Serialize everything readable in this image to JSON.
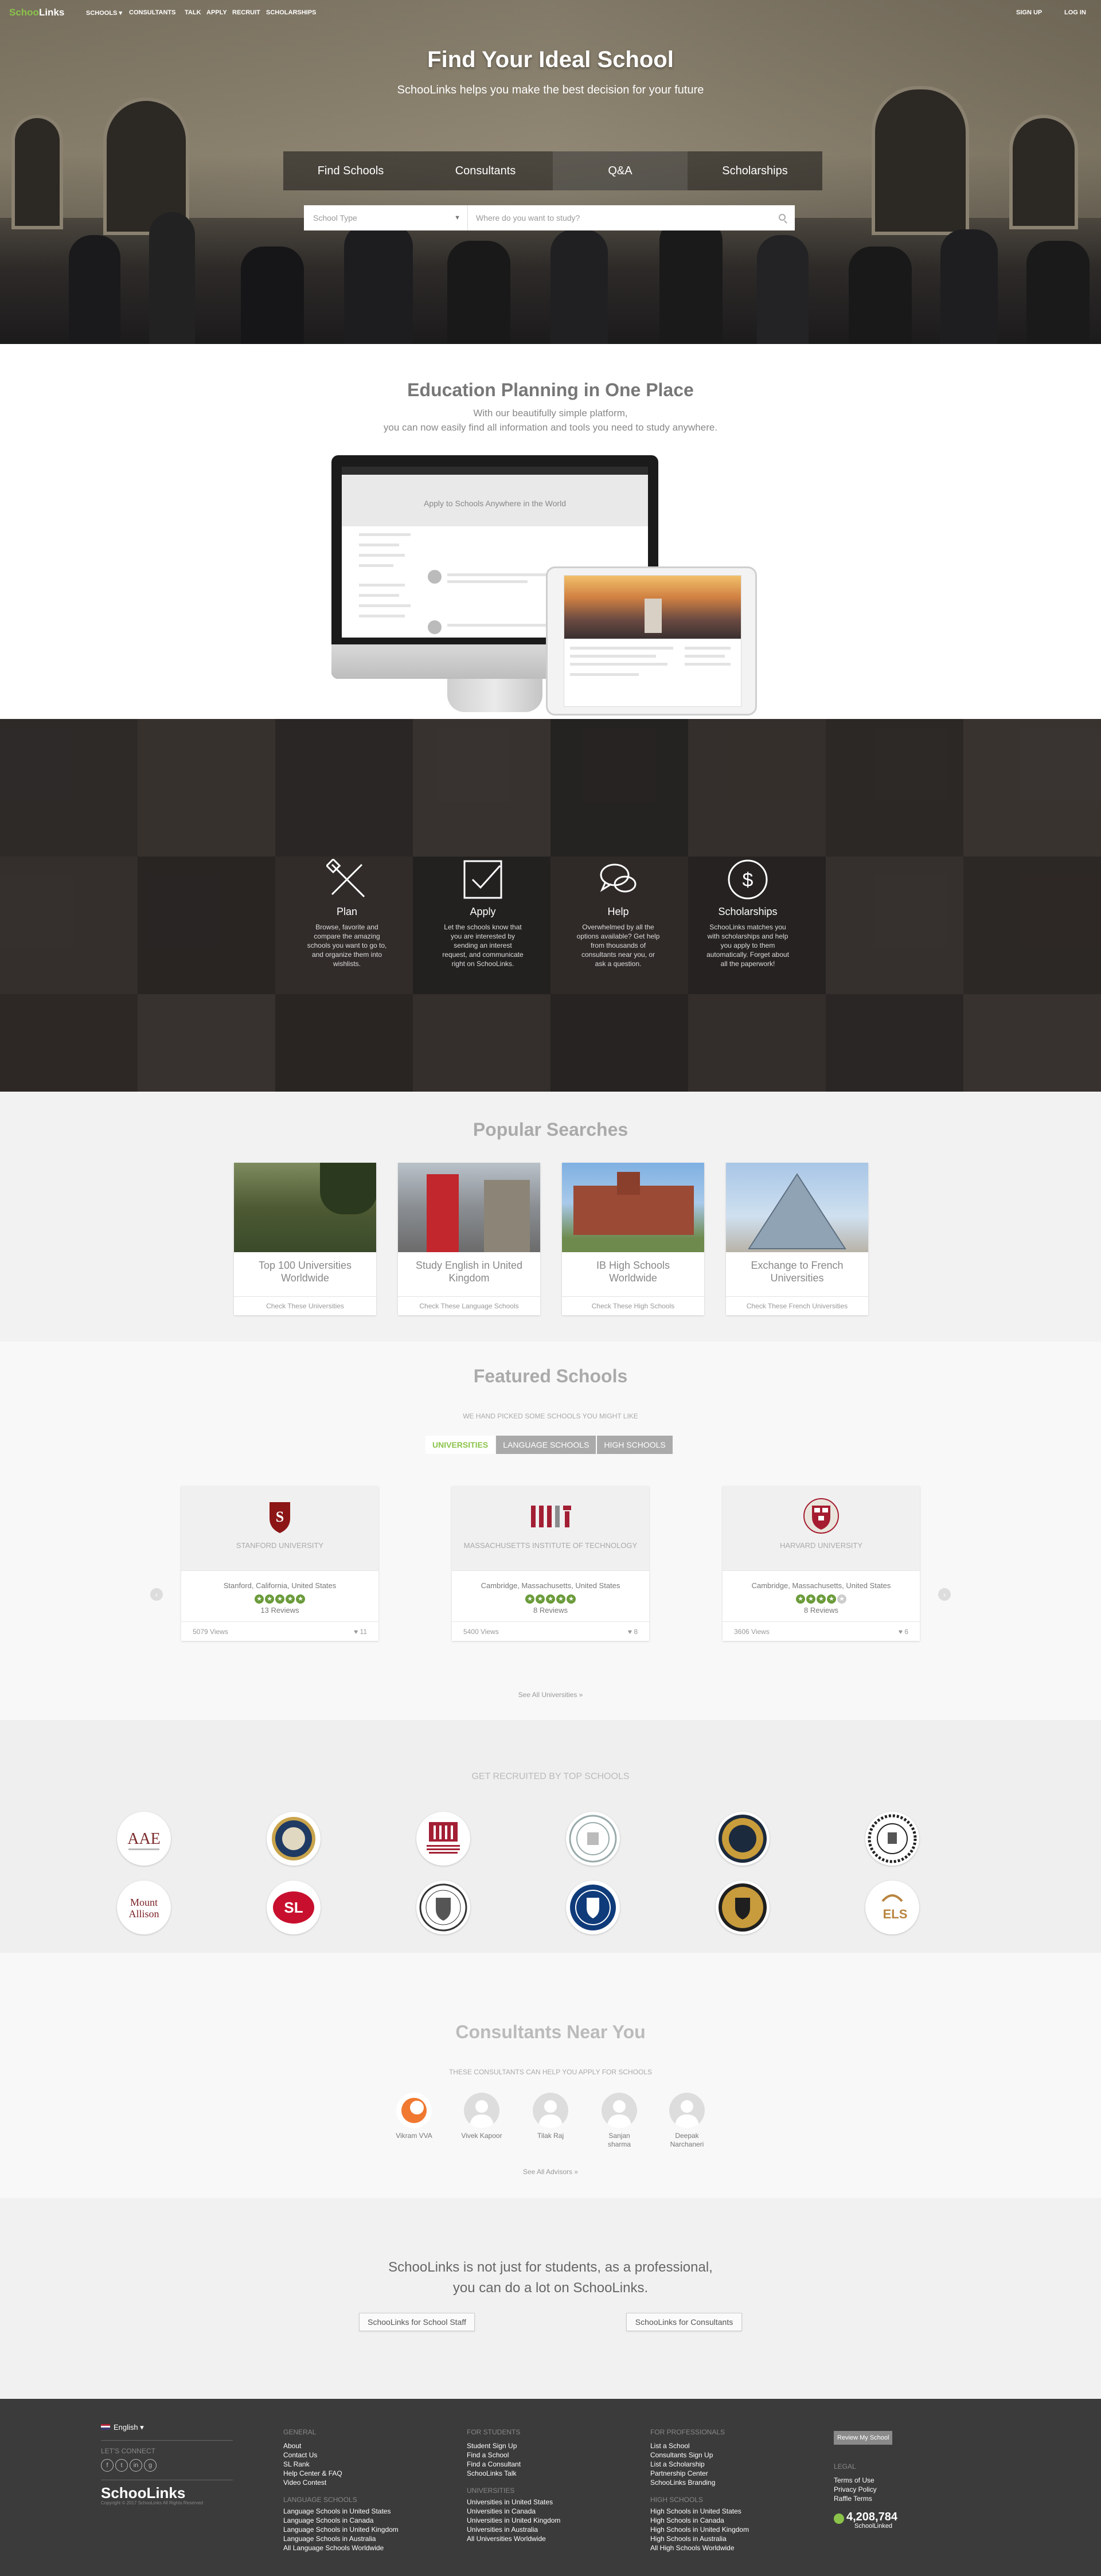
{
  "nav": {
    "logo_prefix": "Schoo",
    "logo_suffix": "Links",
    "items": [
      "SCHOOLS",
      "CONSULTANTS",
      "TALK",
      "APPLY",
      "RECRUIT",
      "SCHOLARSHIPS"
    ],
    "sign_up": "SIGN UP",
    "log_in": "LOG IN"
  },
  "hero": {
    "title": "Find Your Ideal School",
    "subtitle": "SchooLinks helps you make the best decision for your future",
    "tabs": [
      "Find Schools",
      "Consultants",
      "Q&A",
      "Scholarships"
    ],
    "school_type_placeholder": "School Type",
    "where_placeholder": "Where do you want to study?"
  },
  "planning": {
    "title": "Education Planning in One Place",
    "subtitle_1": "With our beautifully simple platform,",
    "subtitle_2": "you can now easily find all information and tools you need to study anywhere.",
    "mock_heading": "Apply to Schools Anywhere in the World"
  },
  "features": [
    {
      "title": "Plan",
      "text": "Browse, favorite and compare the amazing schools you want to go to, and organize them into wishlists.",
      "icon": "pencil-ruler-icon"
    },
    {
      "title": "Apply",
      "text": "Let the schools know that you are interested by sending an interest request, and communicate right on SchooLinks.",
      "icon": "checkbox-icon"
    },
    {
      "title": "Help",
      "text": "Overwhelmed by all the options available? Get help from thousands of consultants near you, or ask a question.",
      "icon": "chat-bubbles-icon"
    },
    {
      "title": "Scholarships",
      "text": "SchooLinks matches you with scholarships and help you apply to them automatically. Forget about all the paperwork!",
      "icon": "dollar-icon"
    }
  ],
  "popular": {
    "title": "Popular Searches",
    "cards": [
      {
        "title": "Top 100 Universities Worldwide",
        "link": "Check These Universities"
      },
      {
        "title": "Study English in United Kingdom",
        "link": "Check These Language Schools"
      },
      {
        "title": "IB High Schools Worldwide",
        "link": "Check These High Schools"
      },
      {
        "title": "Exchange to French Universities",
        "link": "Check These French Universities"
      }
    ]
  },
  "featured": {
    "title": "Featured Schools",
    "subtitle": "WE HAND PICKED SOME SCHOOLS YOU MIGHT LIKE",
    "tabs": [
      "UNIVERSITIES",
      "LANGUAGE SCHOOLS",
      "HIGH SCHOOLS"
    ],
    "schools": [
      {
        "name": "STANFORD UNIVERSITY",
        "location": "Stanford, California, United States",
        "reviews": "13 Reviews",
        "views": "5079 Views",
        "likes": "11",
        "rating": 5,
        "logo_color": "#8c1515"
      },
      {
        "name": "MASSACHUSETTS INSTITUTE OF TECHNOLOGY",
        "location": "Cambridge, Massachusetts, United States",
        "reviews": "8 Reviews",
        "views": "5400 Views",
        "likes": "8",
        "rating": 5,
        "logo_color": "#a31f34"
      },
      {
        "name": "HARVARD UNIVERSITY",
        "location": "Cambridge, Massachusetts, United States",
        "reviews": "8 Reviews",
        "views": "3606 Views",
        "likes": "6",
        "rating": 4,
        "logo_color": "#a51c30"
      }
    ],
    "see_all": "See All Universities »"
  },
  "recruit": {
    "title": "GET RECRUITED BY TOP SCHOOLS"
  },
  "consultants": {
    "title": "Consultants Near You",
    "subtitle": "THESE CONSULTANTS CAN HELP YOU APPLY FOR SCHOOLS",
    "people": [
      "Vikram VVA",
      "Vivek Kapoor",
      "Tilak Raj",
      "Sanjan sharma",
      "Deepak Narchaneri"
    ],
    "see_all": "See All Advisors »"
  },
  "pro": {
    "line1": "SchooLinks is not just for students, as a professional,",
    "line2": "you can do a lot on SchooLinks.",
    "btn_staff": "SchooLinks for School Staff",
    "btn_consultants": "SchooLinks for Consultants"
  },
  "footer": {
    "language": "English",
    "connect": "LET'S CONNECT",
    "logo": "SchooLinks",
    "copyright": "Copyright © 2017 SchooLinks All Rights Reserved",
    "general_head": "GENERAL",
    "general": [
      "About",
      "Contact Us",
      "SL Rank",
      "Help Center & FAQ",
      "Video Contest"
    ],
    "students_head": "FOR STUDENTS",
    "students": [
      "Student Sign Up",
      "Find a School",
      "Find a Consultant",
      "SchooLinks Talk"
    ],
    "pros_head": "FOR PROFESSIONALS",
    "pros": [
      "List a School",
      "Consultants Sign Up",
      "List a Scholarship",
      "Partnership Center",
      "SchooLinks Branding"
    ],
    "review_btn": "Review My School",
    "legal_head": "LEGAL",
    "legal": [
      "Terms of Use",
      "Privacy Policy",
      "Raffle Terms"
    ],
    "lang_head": "LANGUAGE SCHOOLS",
    "lang": [
      "Language Schools in United States",
      "Language Schools in Canada",
      "Language Schools in United Kingdom",
      "Language Schools in Australia",
      "All Language Schools Worldwide"
    ],
    "uni_head": "UNIVERSITIES",
    "uni": [
      "Universities in United States",
      "Universities in Canada",
      "Universities in United Kingdom",
      "Universities in Australia",
      "All Universities Worldwide"
    ],
    "hs_head": "HIGH SCHOOLS",
    "hs": [
      "High Schools in United States",
      "High Schools in Canada",
      "High Schools in United Kingdom",
      "High Schools in Australia",
      "All High Schools Worldwide"
    ],
    "counter": "4,208,784",
    "counter_label": "SchoolLinked"
  },
  "colors": {
    "brand_green": "#8bc34a",
    "footer_bg": "#3b3b3b",
    "star_green": "#6a9b3a"
  }
}
